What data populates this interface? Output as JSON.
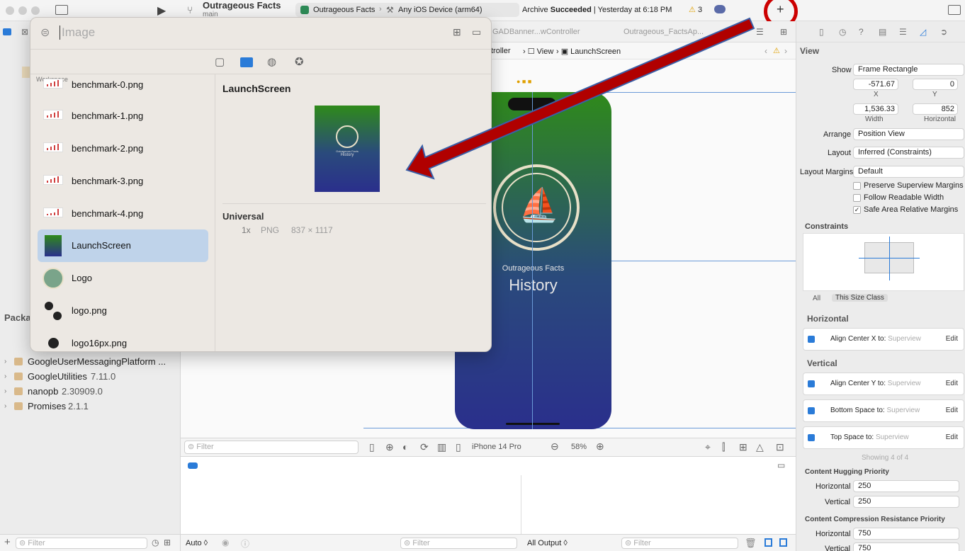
{
  "toolbar": {
    "project": "Outrageous Facts",
    "branch": "main",
    "scheme": "Outrageous Facts",
    "destination": "Any iOS Device (arm64)",
    "status_prefix": "Archive ",
    "status_bold": "Succeeded",
    "status_time": "| Yesterday at 6:18 PM",
    "warnings": "3",
    "add_icon": "+"
  },
  "tabs": [
    "GADBanner...wController",
    "Outrageous_FactsAp..."
  ],
  "breadcrumb": [
    "troller",
    "View",
    "LaunchScreen"
  ],
  "library": {
    "search_placeholder": "Image",
    "workspace_label": "Workspace",
    "items": [
      "benchmark-0.png",
      "benchmark-1.png",
      "benchmark-2.png",
      "benchmark-3.png",
      "benchmark-4.png",
      "LaunchScreen",
      "Logo",
      "logo.png",
      "logo16px.png"
    ],
    "selected": "LaunchScreen",
    "detail": {
      "title": "LaunchScreen",
      "section": "Universal",
      "scale": "1x",
      "format": "PNG",
      "size": "837 × 1117"
    },
    "preview": {
      "subtitle": "Outrageous Facts",
      "title": "History"
    }
  },
  "navigator": {
    "packages_label": "Packa",
    "packages": [
      {
        "name": "GoogleUserMessagingPlatform ...",
        "version": ""
      },
      {
        "name": "GoogleUtilities",
        "version": "7.11.0"
      },
      {
        "name": "nanopb",
        "version": "2.30909.0"
      },
      {
        "name": "Promises",
        "version": "2.1.1"
      }
    ],
    "filter_placeholder": "Filter"
  },
  "canvas": {
    "phone_subtitle": "Outrageous Facts",
    "phone_title": "History",
    "device": "iPhone 14 Pro",
    "zoom": "58%",
    "filter_placeholder": "Filter"
  },
  "debug": {
    "auto": "Auto ◊",
    "filter": "Filter",
    "all_output": "All Output ◊",
    "filter2": "Filter"
  },
  "inspector": {
    "title": "View",
    "show_label": "Show",
    "show_value": "Frame Rectangle",
    "x_value": "-571.67",
    "x_label": "X",
    "y_value": "0",
    "y_label": "Y",
    "w_value": "1,536.33",
    "w_label": "Width",
    "h_value": "852",
    "h_label": "Horizontal",
    "arrange_label": "Arrange",
    "arrange_value": "Position View",
    "layout_label": "Layout",
    "layout_value": "Inferred (Constraints)",
    "margins_label": "Layout Margins",
    "margins_value": "Default",
    "chk1": "Preserve Superview Margins",
    "chk2": "Follow Readable Width",
    "chk3": "Safe Area Relative Margins",
    "constraints_label": "Constraints",
    "all_tab": "All",
    "size_tab": "This Size Class",
    "horizontal": "Horizontal",
    "vertical": "Vertical",
    "c1": "Align Center X to:",
    "c2": "Align Center Y to:",
    "c3": "Bottom Space to:",
    "c4": "Top Space to:",
    "superview": "Superview",
    "edit": "Edit",
    "showing": "Showing 4 of 4",
    "hugging": "Content Hugging Priority",
    "h_val": "250",
    "v_label": "Vertical",
    "v_val": "250",
    "compression": "Content Compression Resistance Priority",
    "ch_label": "Horizontal",
    "ch_val": "750",
    "cv_label": "Vertical",
    "cv_val": "750"
  },
  "colors": {
    "accent": "#2a7bd8",
    "arrow": "#b00000",
    "phone_top": "#2f8a1a",
    "phone_bottom": "#2a2f8c"
  }
}
